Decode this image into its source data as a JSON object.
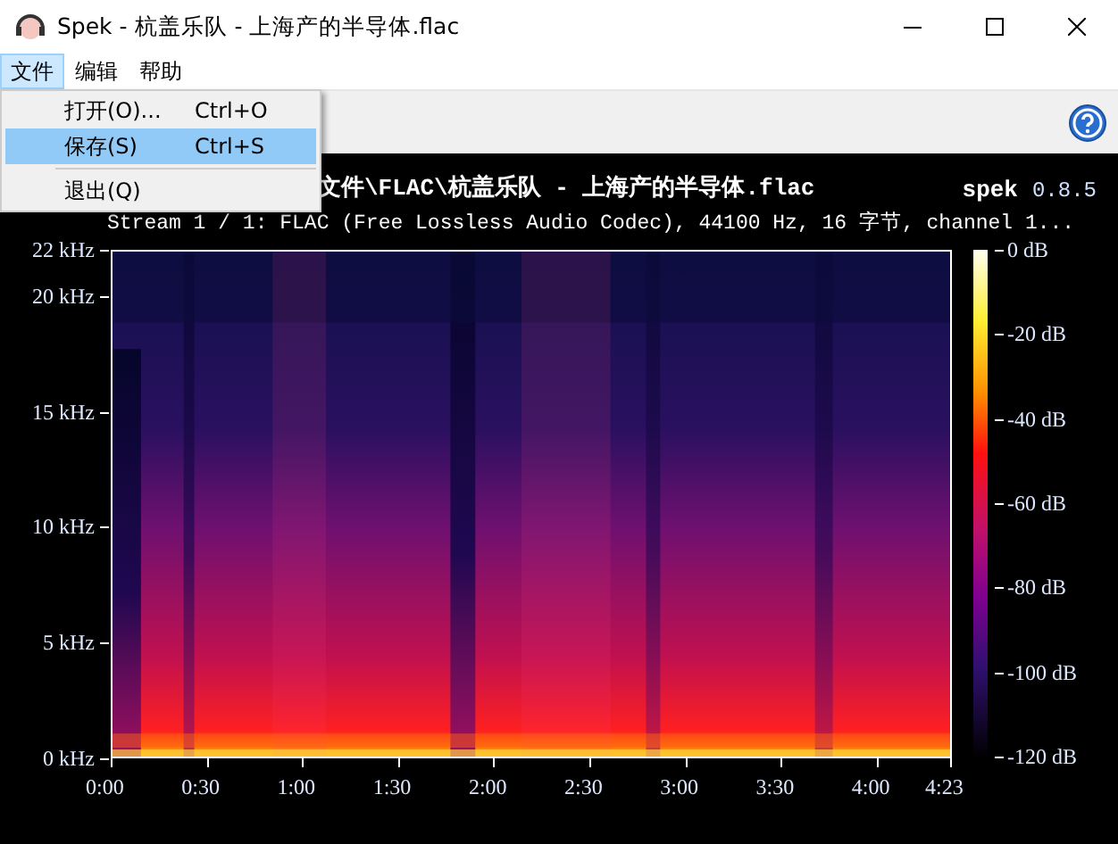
{
  "window": {
    "title": "Spek - 杭盖乐队 - 上海产的半导体.flac"
  },
  "menu_bar": [
    {
      "label": "文件",
      "selected": true
    },
    {
      "label": "编辑",
      "selected": false
    },
    {
      "label": "帮助",
      "selected": false
    }
  ],
  "file_menu": [
    {
      "kind": "item",
      "label": "打开(O)...",
      "shortcut": "Ctrl+O",
      "selected": false
    },
    {
      "kind": "item",
      "label": "保存(S)",
      "shortcut": "Ctrl+S",
      "selected": true
    },
    {
      "kind": "separator"
    },
    {
      "kind": "item",
      "label": "退出(Q)",
      "selected": false
    }
  ],
  "header": {
    "file_path": "文件\\FLAC\\杭盖乐队 - 上海产的半导体.flac",
    "app_name": "spek",
    "version": "0.8.5",
    "stream_info": "Stream 1 / 1: FLAC (Free Lossless Audio Codec), 44100 Hz, 16 字节, channel 1..."
  },
  "frequency_axis": [
    "22 kHz",
    "20 kHz",
    "15 kHz",
    "10 kHz",
    "5 kHz",
    "0 kHz"
  ],
  "time_axis": [
    "0:00",
    "0:30",
    "1:00",
    "1:30",
    "2:00",
    "2:30",
    "3:00",
    "3:30",
    "4:00",
    "4:23"
  ],
  "db_scale": [
    "0 dB",
    "-20 dB",
    "-40 dB",
    "-60 dB",
    "-80 dB",
    "-100 dB",
    "-120 dB"
  ]
}
